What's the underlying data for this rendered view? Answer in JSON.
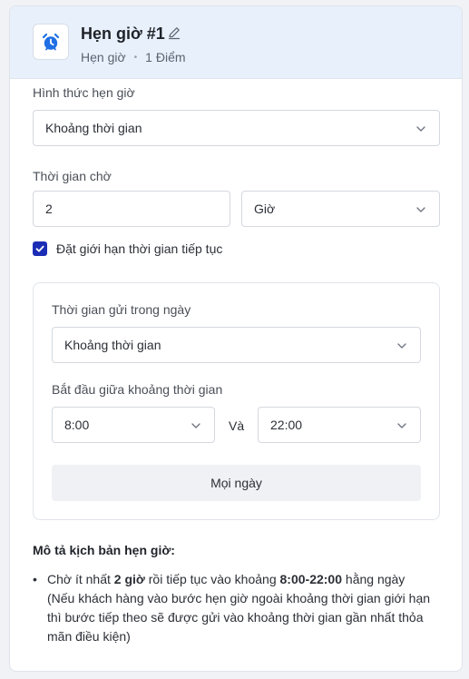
{
  "header": {
    "title": "Hẹn giờ #1",
    "type": "Hẹn giờ",
    "separator": "•",
    "points": "1 Điểm"
  },
  "schedule_type": {
    "label": "Hình thức hẹn giờ",
    "value": "Khoảng thời gian"
  },
  "wait_time": {
    "label": "Thời gian chờ",
    "value": "2",
    "unit": "Giờ"
  },
  "limit": {
    "checked": true,
    "label": "Đặt giới hạn thời gian tiếp tục"
  },
  "send_time": {
    "label": "Thời gian gửi trong ngày",
    "value": "Khoảng thời gian"
  },
  "range": {
    "label": "Bắt đầu giữa khoảng thời gian",
    "start": "8:00",
    "connector": "Và",
    "end": "22:00"
  },
  "days_button": "Mọi ngày",
  "description": {
    "title": "Mô tả kịch bản hẹn giờ:",
    "bullet": "•",
    "part1": "Chờ ít nhất ",
    "bold1": "2 giờ",
    "part2": " rồi tiếp tục vào khoảng ",
    "bold2": "8:00-22:00",
    "part3": " hằng ngày (Nếu khách hàng vào bước hẹn giờ ngoài khoảng thời gian giới hạn thì bước tiếp theo sẽ được gửi vào khoảng thời gian gần nhất thỏa mãn điều kiện)"
  },
  "colors": {
    "header_bg": "#e8f0fc",
    "accent": "#1b2db5",
    "clock_icon": "#1f6fe5"
  },
  "icons": {
    "header": "alarm-clock-icon",
    "edit": "pencil-icon",
    "dropdown": "chevron-down-icon",
    "check": "check-icon"
  }
}
